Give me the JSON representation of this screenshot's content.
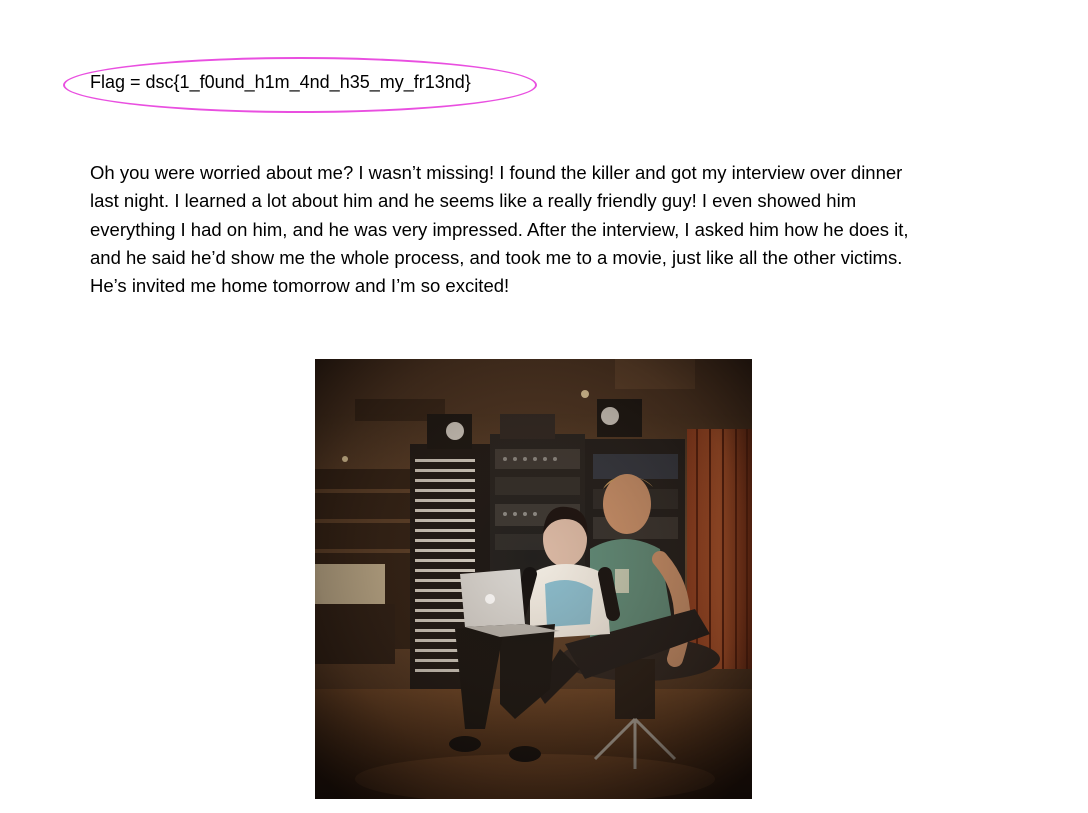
{
  "flag": {
    "text": "Flag = dsc{1_f0und_h1m_4nd_h35_my_fr13nd}",
    "highlight_color": "#e94fe0"
  },
  "message": {
    "lines": [
      "Oh you were worried about me? I wasn’t missing! I found the killer and got my interview over dinner",
      "last night. I learned a lot about him and he seems like a really friendly guy! I even showed him",
      "everything I had on him, and he was very impressed. After the interview, I asked him how he does it,",
      "and he said he’d show me the whole process, and took me to a movie, just like all the other victims.",
      "He’s invited me home tomorrow and I’m so excited!"
    ]
  },
  "photo": {
    "subject": "two people sitting in a recording studio looking at a laptop"
  }
}
